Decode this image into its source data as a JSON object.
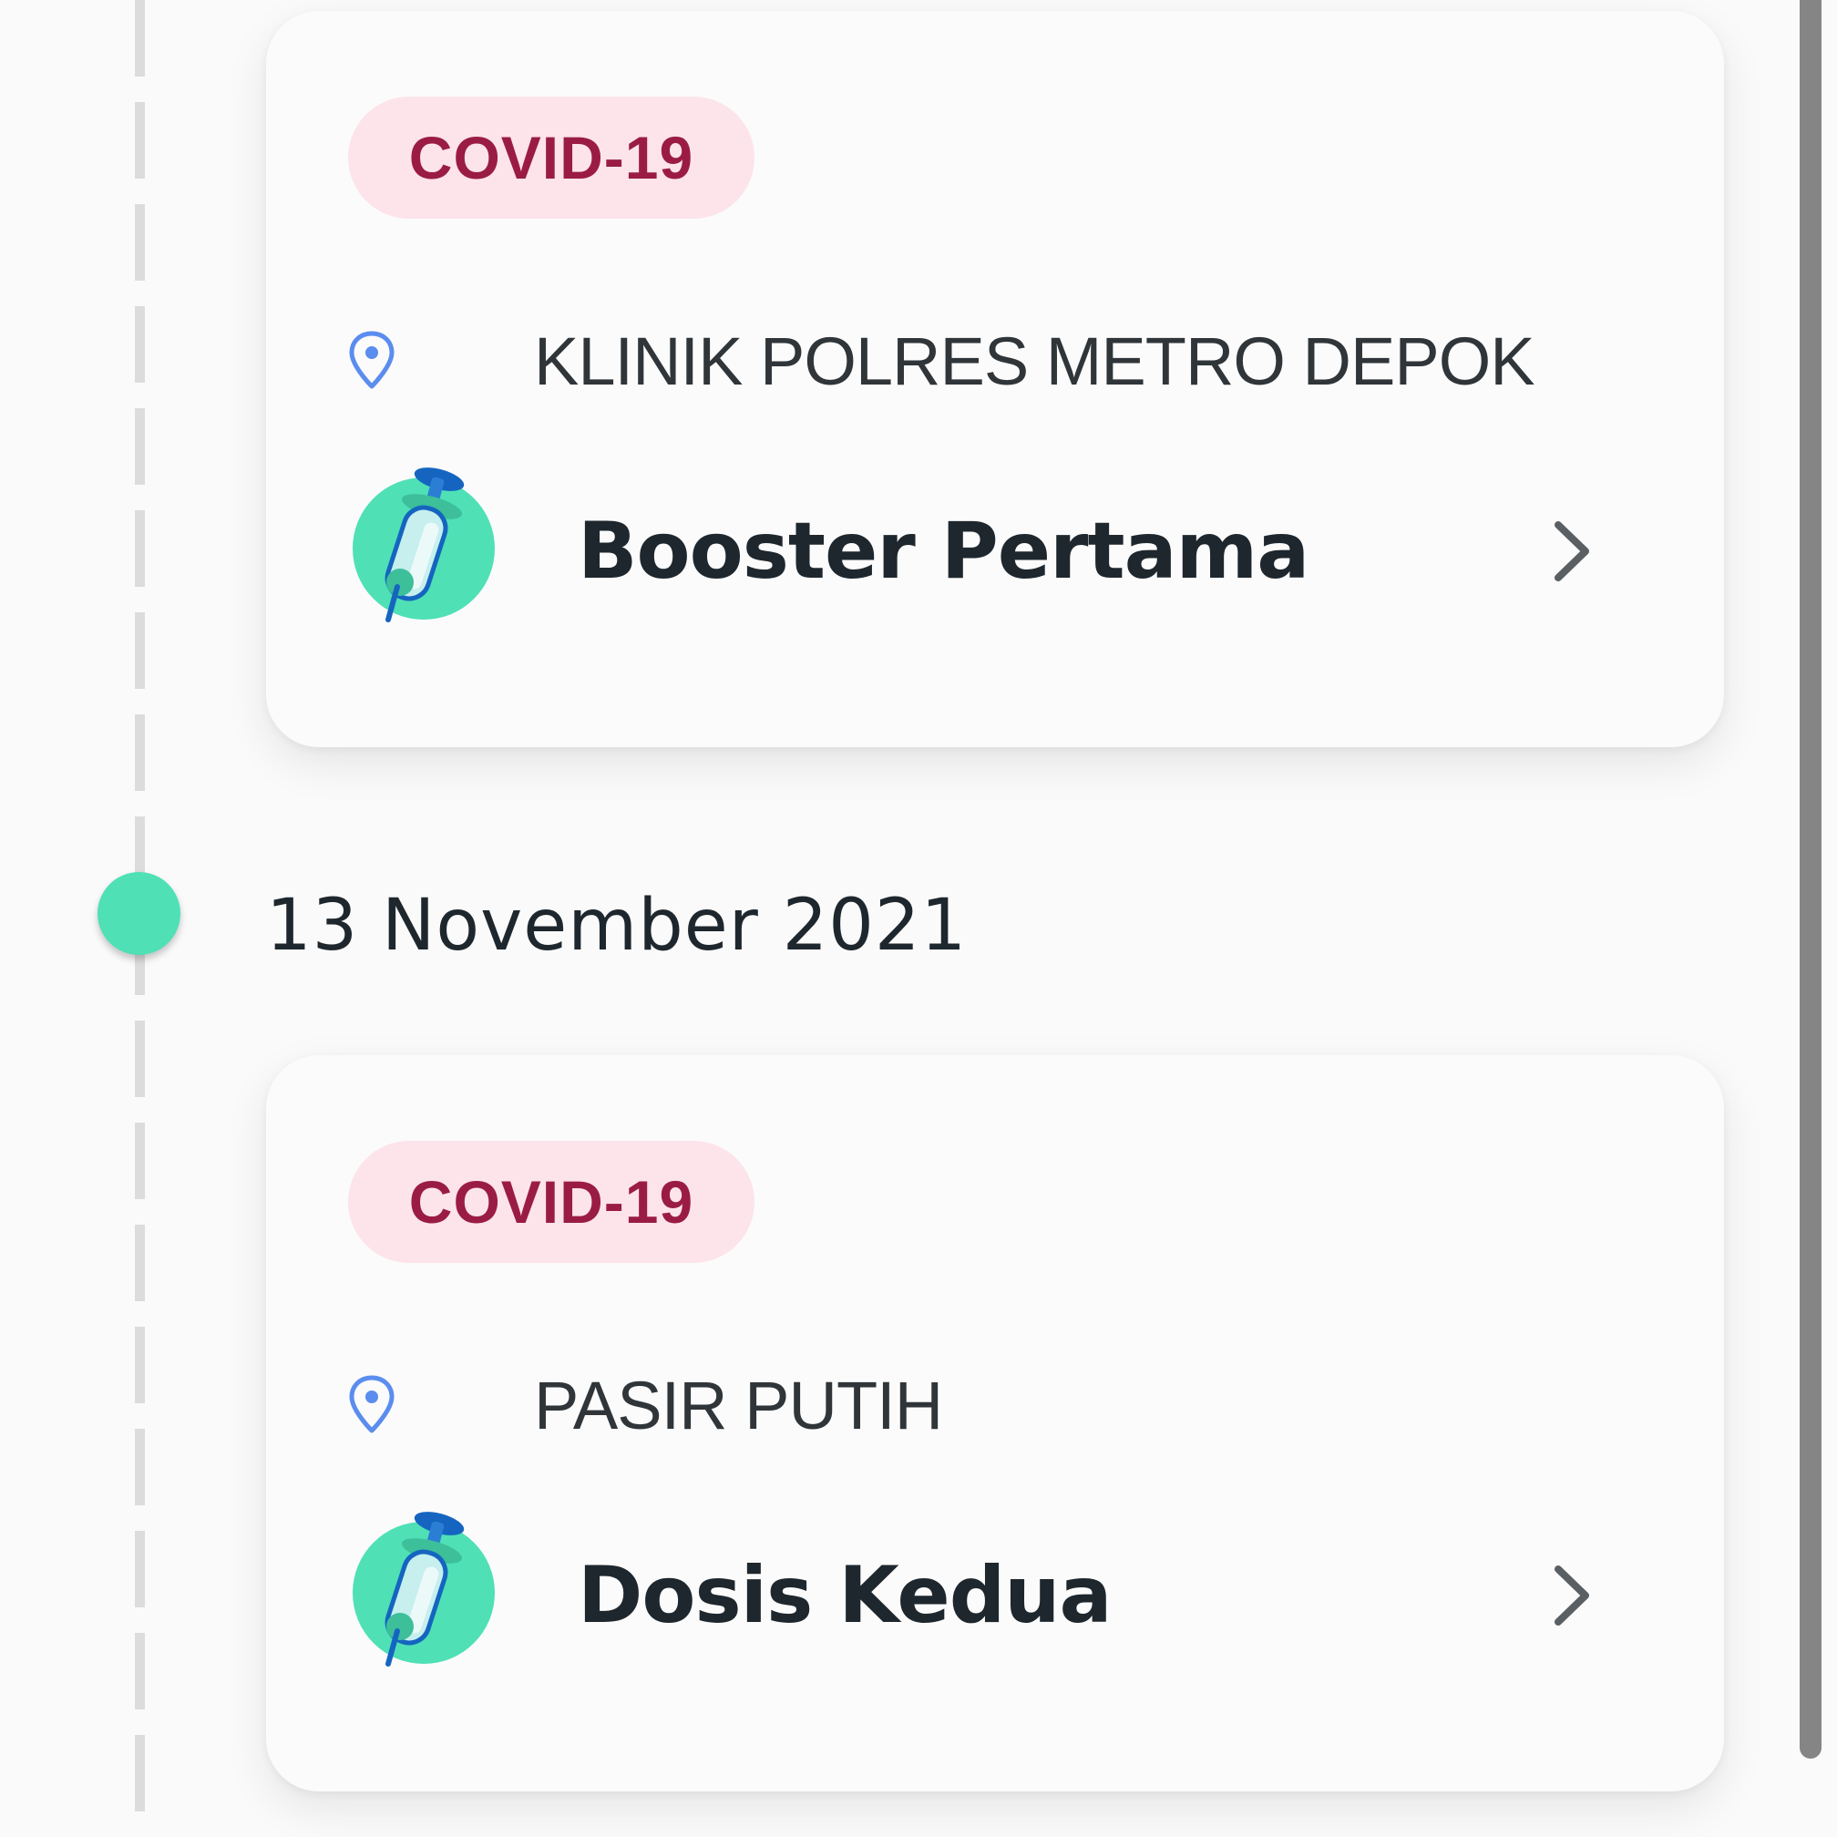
{
  "timeline": {
    "date": "13 November 2021"
  },
  "records": [
    {
      "category": "COVID-19",
      "location": "KLINIK POLRES METRO DEPOK",
      "dose": "Booster Pertama",
      "icon": "vaccine-syringe-icon"
    },
    {
      "category": "COVID-19",
      "location": "PASIR PUTIH",
      "dose": "Dosis Kedua",
      "icon": "vaccine-syringe-icon"
    }
  ],
  "colors": {
    "badge_bg": "#fce4ea",
    "badge_text": "#9a1c44",
    "accent_green": "#4fe0b6",
    "pin_blue": "#5b8def",
    "text_dark": "#1e272e"
  }
}
